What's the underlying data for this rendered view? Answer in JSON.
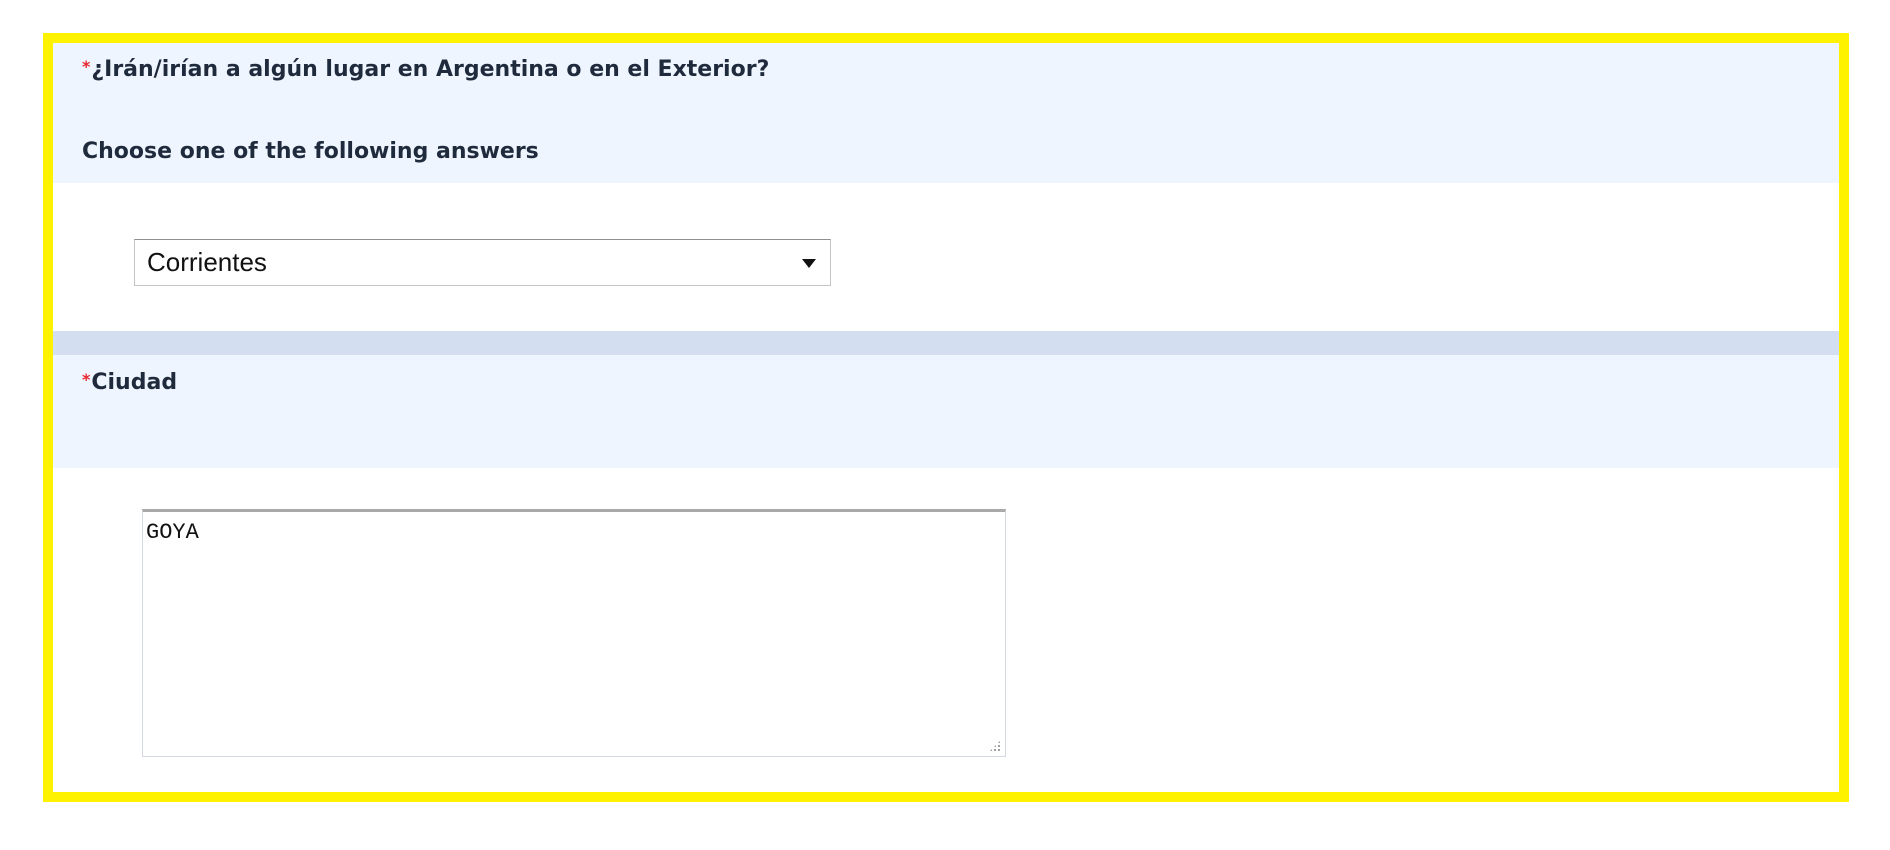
{
  "question1": {
    "required_marker": "*",
    "title": "¿Irán/irían a algún lugar en Argentina o en el Exterior?",
    "instruction": "Choose one of the following answers",
    "selected_value": "Corrientes"
  },
  "question2": {
    "required_marker": "*",
    "title": "Ciudad",
    "value": "GOYA"
  },
  "colors": {
    "highlight_border": "#fff200",
    "header_bg": "#eef5fe",
    "separator": "#d3dff0",
    "required": "#e8262b"
  }
}
